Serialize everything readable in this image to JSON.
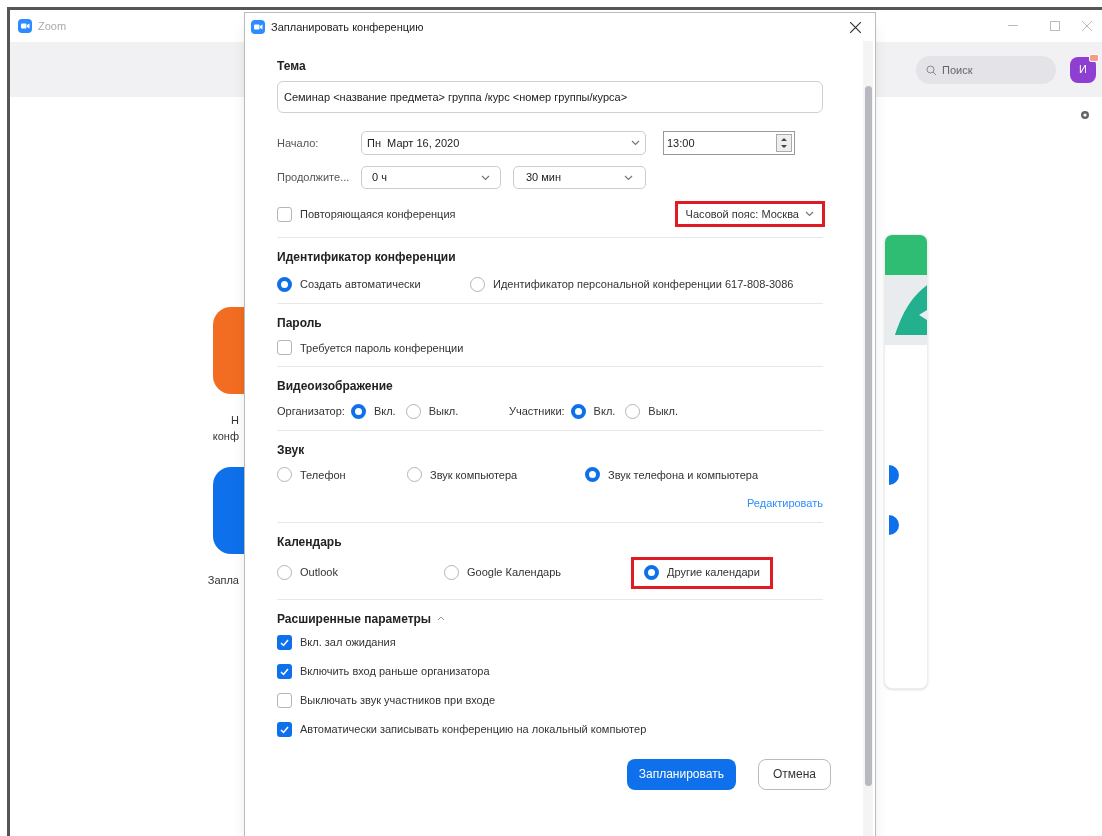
{
  "app": {
    "title": "Zoom",
    "search": {
      "placeholder": "Поиск"
    },
    "avatar": "И",
    "tiles": [
      {
        "lines": [
          "Н",
          "конф"
        ],
        "color": "#f26d21"
      },
      {
        "lines": [
          "Запла"
        ],
        "color": "#0e71eb"
      }
    ]
  },
  "dialog": {
    "title": "Запланировать конференцию",
    "topic": {
      "label": "Тема",
      "value": "Семинар <название предмета> группа /курс <номер группы/курса>"
    },
    "start": {
      "label": "Начало:",
      "date": "Пн  Март 16, 2020",
      "time": "13:00"
    },
    "duration": {
      "label": "Продолжите...",
      "hours": "0 ч",
      "minutes": "30 мин"
    },
    "recurring": {
      "label": "Повторяющаяся конференция",
      "checked": false
    },
    "timezone": {
      "label": "Часовой пояс: Москва",
      "highlighted": true
    },
    "meeting_id": {
      "title": "Идентификатор конференции",
      "options": [
        {
          "label": "Создать автоматически",
          "selected": true
        },
        {
          "label": "Идентификатор персональной конференции 617-808-3086",
          "selected": false
        }
      ]
    },
    "password": {
      "title": "Пароль",
      "label": "Требуется пароль конференции",
      "checked": false
    },
    "video": {
      "title": "Видеоизображение",
      "groups": [
        {
          "label": "Организатор:",
          "options": [
            {
              "label": "Вкл.",
              "selected": true
            },
            {
              "label": "Выкл.",
              "selected": false
            }
          ]
        },
        {
          "label": "Участники:",
          "options": [
            {
              "label": "Вкл.",
              "selected": true
            },
            {
              "label": "Выкл.",
              "selected": false
            }
          ]
        }
      ]
    },
    "audio": {
      "title": "Звук",
      "options": [
        {
          "label": "Телефон",
          "selected": false
        },
        {
          "label": "Звук компьютера",
          "selected": false
        },
        {
          "label": "Звук телефона и компьютера",
          "selected": true
        }
      ],
      "edit_link": "Редактировать"
    },
    "calendar": {
      "title": "Календарь",
      "options": [
        {
          "label": "Outlook",
          "selected": false,
          "highlighted": false
        },
        {
          "label": "Google Календарь",
          "selected": false,
          "highlighted": false
        },
        {
          "label": "Другие календари",
          "selected": true,
          "highlighted": true
        }
      ]
    },
    "advanced": {
      "title": "Расширенные параметры",
      "expanded": true,
      "options": [
        {
          "label": "Вкл. зал ожидания",
          "checked": true
        },
        {
          "label": "Включить вход раньше организатора",
          "checked": true
        },
        {
          "label": "Выключать звук участников при входе",
          "checked": false
        },
        {
          "label": "Автоматически записывать конференцию на локальный компьютер",
          "checked": true
        }
      ]
    },
    "buttons": [
      {
        "label": "Запланировать",
        "kind": "primary"
      },
      {
        "label": "Отмена",
        "kind": "secondary"
      }
    ]
  }
}
